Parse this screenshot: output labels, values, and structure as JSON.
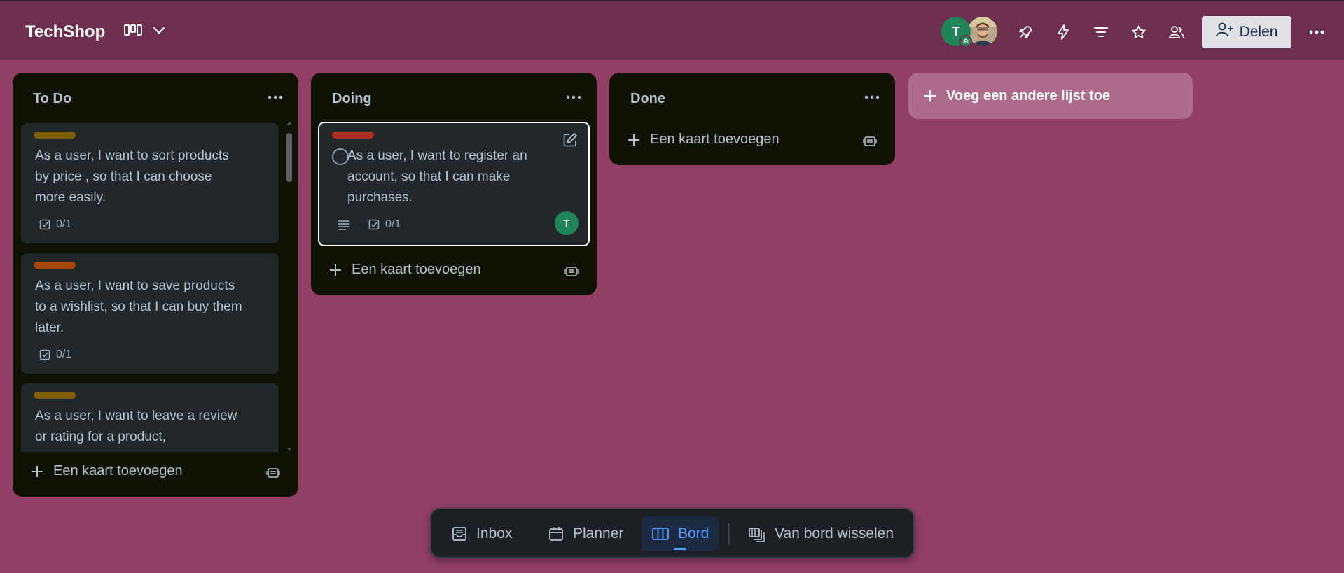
{
  "header": {
    "board_title": "TechShop",
    "view_icon": "board-view-icon",
    "member_initial": "T",
    "share_label": "Delen",
    "colors": {
      "bar": "#6e2f4f",
      "member_green": "#1f845a"
    }
  },
  "lists": [
    {
      "title": "To Do",
      "cards": [
        {
          "label_color": "#7f5f01",
          "text": "As a user, I want to sort products by price , so that I can choose more easily.",
          "checklist": "0/1"
        },
        {
          "label_color": "#a54800",
          "text": "As a user, I want to save products to a wishlist, so that I can buy them later.",
          "checklist": "0/1"
        },
        {
          "label_color": "#7f5f01",
          "text": "As a user, I want to leave a review or rating for a product,"
        }
      ],
      "add_card": "Een kaart toevoegen"
    },
    {
      "title": "Doing",
      "cards": [
        {
          "label_color": "#ae2e24",
          "text": "As a user, I want to register an account, so that I can make purchases.",
          "checklist": "0/1",
          "member": "T"
        }
      ],
      "add_card": "Een kaart toevoegen"
    },
    {
      "title": "Done",
      "cards": [],
      "add_card": "Een kaart toevoegen"
    }
  ],
  "add_list_label": "Voeg een andere lijst toe",
  "bottom_nav": {
    "items": [
      {
        "label": "Inbox",
        "icon": "inbox-icon"
      },
      {
        "label": "Planner",
        "icon": "calendar-icon"
      },
      {
        "label": "Bord",
        "icon": "board-icon",
        "active": true
      },
      {
        "label": "Van bord wisselen",
        "icon": "switch-board-icon"
      }
    ]
  }
}
